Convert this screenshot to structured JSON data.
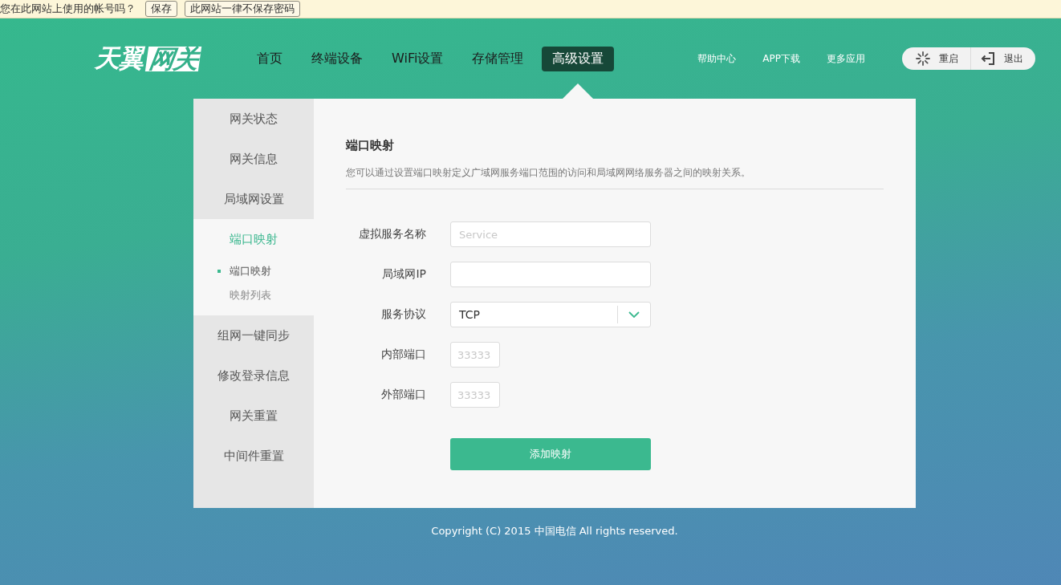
{
  "password_prompt": {
    "message": "您在此网站上使用的帐号吗？",
    "buttons": [
      "保存",
      "此网站一律不保存密码"
    ]
  },
  "header": {
    "logo": {
      "main": "天翼",
      "boxed": "网关"
    },
    "nav": [
      {
        "label": "首页",
        "selected": false
      },
      {
        "label": "终端设备",
        "selected": false
      },
      {
        "label": "WiFi设置",
        "selected": false
      },
      {
        "label": "存储管理",
        "selected": false
      },
      {
        "label": "高级设置",
        "selected": true
      }
    ],
    "links": [
      "帮助中心",
      "APP下载",
      "更多应用"
    ],
    "actions": [
      {
        "kind": "restart",
        "label": "重启"
      },
      {
        "kind": "logout",
        "label": "退出"
      }
    ]
  },
  "sidebar": {
    "items": [
      {
        "label": "网关状态",
        "selected": false
      },
      {
        "label": "网关信息",
        "selected": false
      },
      {
        "label": "局域网设置",
        "selected": false
      },
      {
        "label": "端口映射",
        "selected": true,
        "children": [
          {
            "label": "端口映射",
            "selected": true
          },
          {
            "label": "映射列表",
            "selected": false
          }
        ]
      },
      {
        "label": "组网一键同步",
        "selected": false
      },
      {
        "label": "修改登录信息",
        "selected": false
      },
      {
        "label": "网关重置",
        "selected": false
      },
      {
        "label": "中间件重置",
        "selected": false
      }
    ]
  },
  "panel": {
    "title": "端口映射",
    "description": "您可以通过设置端口映射定义广域网服务端口范围的访问和局域网网络服务器之间的映射关系。",
    "fields": [
      {
        "label": "虚拟服务名称",
        "kind": "text",
        "placeholder": "Service"
      },
      {
        "label": "局域网IP",
        "kind": "text"
      },
      {
        "label": "服务协议",
        "kind": "select",
        "value": "TCP"
      },
      {
        "label": "内部端口",
        "kind": "port",
        "placeholder": "33333"
      },
      {
        "label": "外部端口",
        "kind": "port",
        "placeholder": "33333"
      }
    ],
    "submit": "添加映射"
  },
  "footer": "Copyright (C) 2015 中国电信 All rights reserved."
}
